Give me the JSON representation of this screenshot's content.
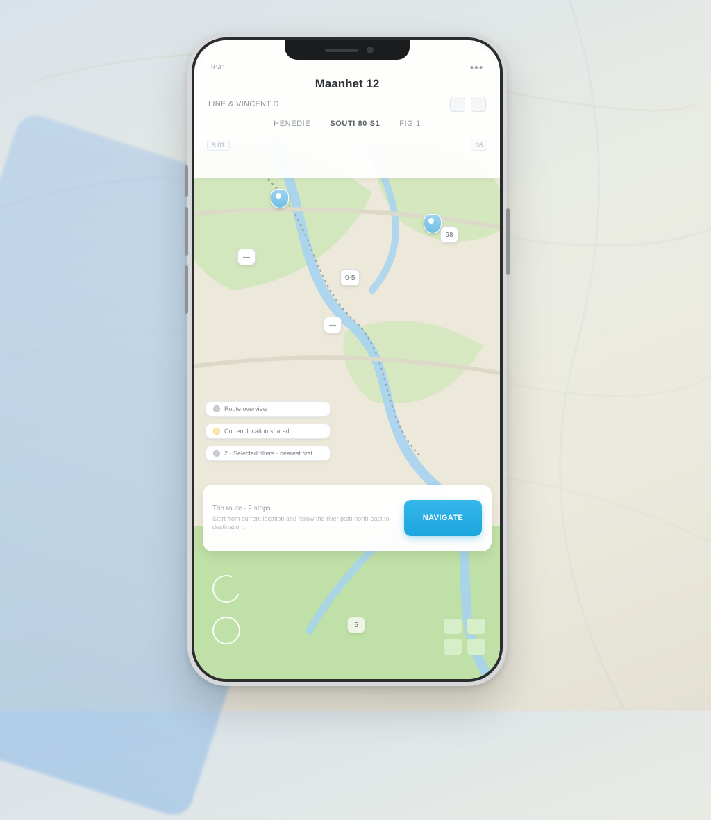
{
  "status": {
    "left": "9:41",
    "right": "●●●"
  },
  "header": {
    "title": "Maanhet 12",
    "subtitle_left": "LINE & VINCENT D",
    "segments": [
      "HENEDIE",
      "SOUTI 80 S1",
      "FIG 1"
    ],
    "badges": [
      "S 01",
      "08"
    ]
  },
  "poi": {
    "a": "0-5",
    "b": "98",
    "c": "—",
    "d": "—",
    "e": "5"
  },
  "overlay": {
    "chip1": "Route overview",
    "chip2": "Current location shared",
    "chip3": "2 · Selected filters · nearest first"
  },
  "card": {
    "eyebrow": "Trip route · 2 stops",
    "body": "Start from current location and follow the river path north-east to destination.",
    "cta": "NAVIGATE"
  },
  "colors": {
    "accent": "#1ea6de",
    "park": "#cfe6b8",
    "water": "#a6d3ef",
    "road": "#e9e6d8"
  }
}
